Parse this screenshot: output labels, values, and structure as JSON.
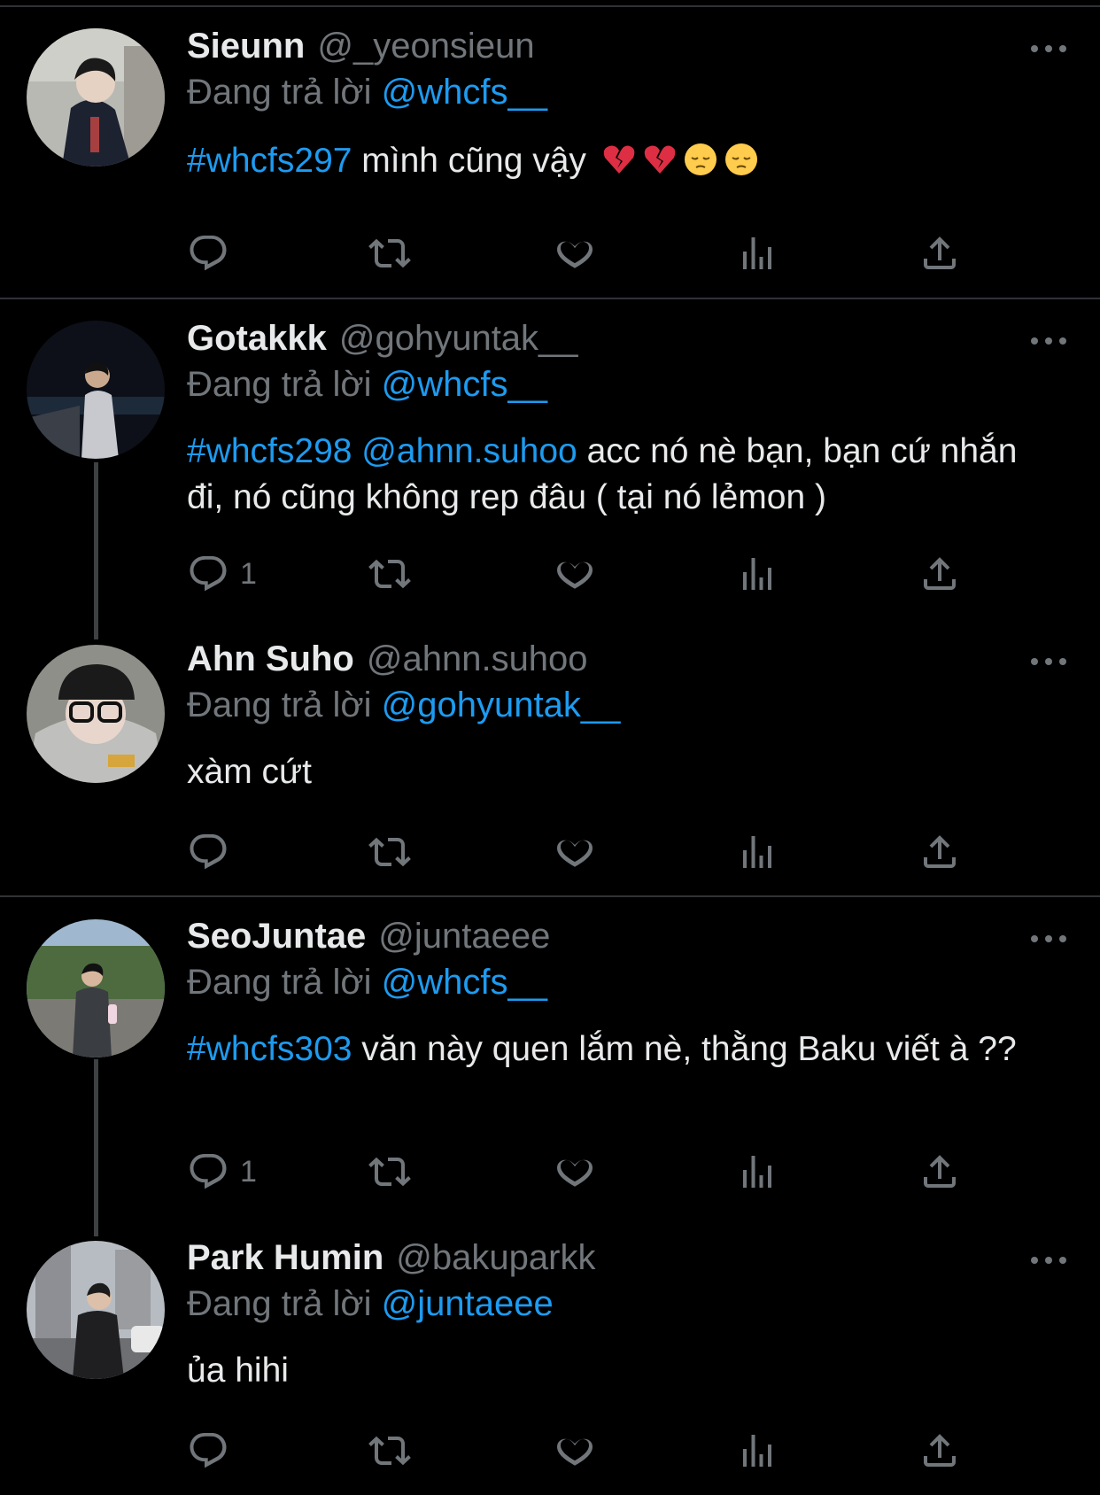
{
  "tweets": [
    {
      "name": "Sieunn",
      "handle": "@_yeonsieun",
      "reply_prefix": "Đang trả lời",
      "reply_to": "@whcfs__",
      "hashtag": "#whcfs297",
      "mention": "",
      "text": " mình cũng vậy",
      "emojis": [
        "broken-heart",
        "broken-heart",
        "pensive-face",
        "pensive-face"
      ],
      "reply_count": ""
    },
    {
      "name": "Gotakkk",
      "handle": "@gohyuntak__",
      "reply_prefix": "Đang trả lời",
      "reply_to": "@whcfs__",
      "hashtag": "#whcfs298",
      "mention": "@ahnn.suhoo",
      "text": " acc nó nè bạn, bạn cứ nhắn đi, nó cũng không rep đâu ( tại nó lẻmon )",
      "reply_count": "1"
    },
    {
      "name": "Ahn Suho",
      "handle": "@ahnn.suhoo",
      "reply_prefix": "Đang trả lời",
      "reply_to": "@gohyuntak__",
      "hashtag": "",
      "mention": "",
      "text": "xàm cứt",
      "reply_count": ""
    },
    {
      "name": "SeoJuntae",
      "handle": "@juntaeee",
      "reply_prefix": "Đang trả lời",
      "reply_to": "@whcfs__",
      "hashtag": "#whcfs303",
      "mention": "",
      "text": " văn này quen lắm nè, thằng Baku viết à ??",
      "reply_count": "1"
    },
    {
      "name": "Park Humin",
      "handle": "@bakuparkk",
      "reply_prefix": "Đang trả lời",
      "reply_to": "@juntaeee",
      "hashtag": "",
      "mention": "",
      "text": "ủa hihi",
      "reply_count": ""
    }
  ],
  "colors": {
    "background": "#000000",
    "text": "#e7e9ea",
    "muted": "#71767b",
    "link": "#1d9bf0",
    "divider": "#2f3336"
  },
  "icons": [
    "reply-icon",
    "retweet-icon",
    "like-icon",
    "analytics-icon",
    "share-icon",
    "more-icon"
  ]
}
